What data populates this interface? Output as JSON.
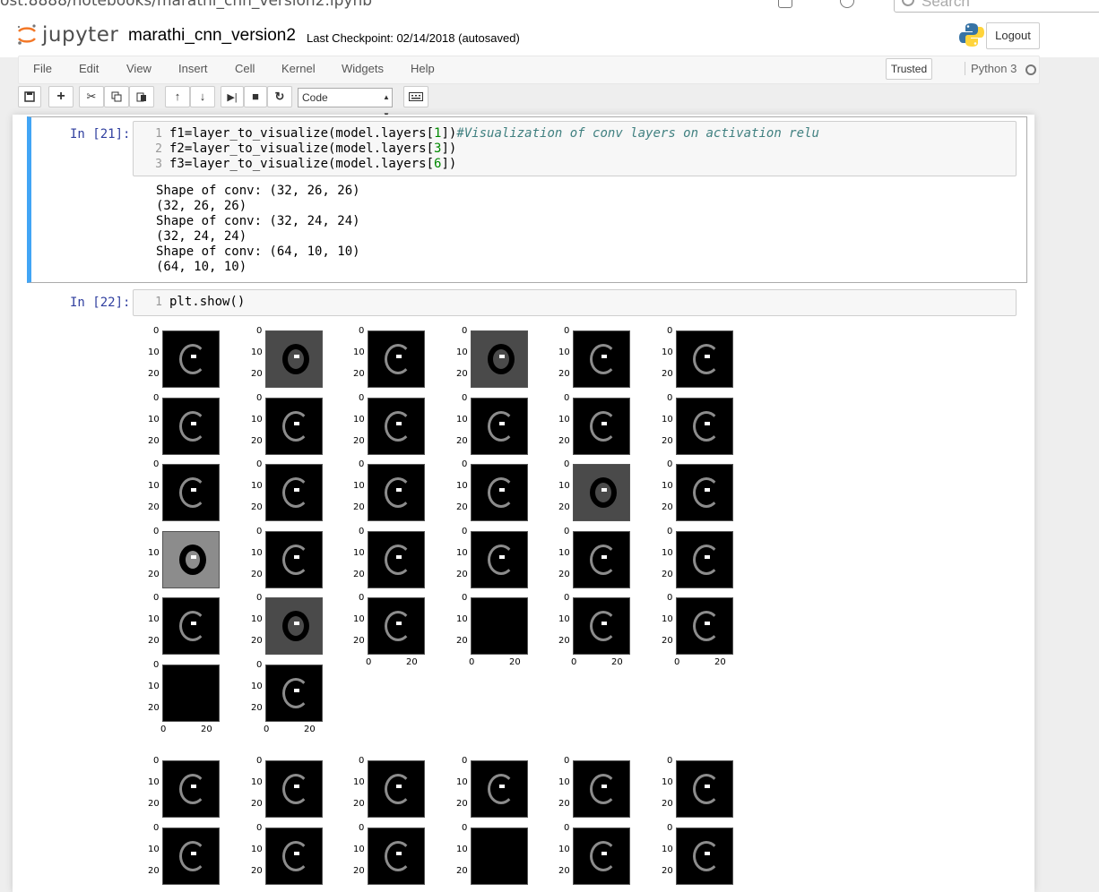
{
  "browser": {
    "url": "ost:8888/notebooks/marathi_cnn_version2.ipynb",
    "search_placeholder": "Search"
  },
  "header": {
    "logo_text": "jupyter",
    "notebook_name": "marathi_cnn_version2",
    "checkpoint": "Last Checkpoint: 02/14/2018 (autosaved)",
    "logout_label": "Logout"
  },
  "menu": {
    "items": [
      "File",
      "Edit",
      "View",
      "Insert",
      "Cell",
      "Kernel",
      "Widgets",
      "Help"
    ],
    "trusted_label": "Trusted",
    "kernel_name": "Python 3"
  },
  "toolbar": {
    "cell_type": "Code",
    "icons": [
      "save-icon",
      "plus-icon",
      "cut-icon",
      "copy-icon",
      "paste-icon",
      "arrow-up-icon",
      "arrow-down-icon",
      "run-icon",
      "stop-icon",
      "restart-icon",
      "keyboard-icon"
    ]
  },
  "cells": [
    {
      "prompt": "In [21]:",
      "lines": [
        {
          "n": "1",
          "pre": "f1=layer_to_visualize(model.layers[",
          "num": "1",
          "post": "])",
          "comment": "#Visualization of conv layers on activation relu"
        },
        {
          "n": "2",
          "pre": "f2=layer_to_visualize(model.layers[",
          "num": "3",
          "post": "])",
          "comment": ""
        },
        {
          "n": "3",
          "pre": "f3=layer_to_visualize(model.layers[",
          "num": "6",
          "post": "])",
          "comment": ""
        }
      ],
      "output": [
        "Shape of conv: (32, 26, 26)",
        "(32, 26, 26)",
        "Shape of conv: (32, 24, 24)",
        "(32, 24, 24)",
        "Shape of conv: (64, 10, 10)",
        "(64, 10, 10)"
      ]
    },
    {
      "prompt": "In [22]:",
      "lines": [
        {
          "n": "1",
          "code": "plt.show()"
        }
      ]
    }
  ],
  "figure": {
    "y_ticks": [
      "0",
      "10",
      "20"
    ],
    "x_ticks": [
      "0",
      "20"
    ]
  }
}
